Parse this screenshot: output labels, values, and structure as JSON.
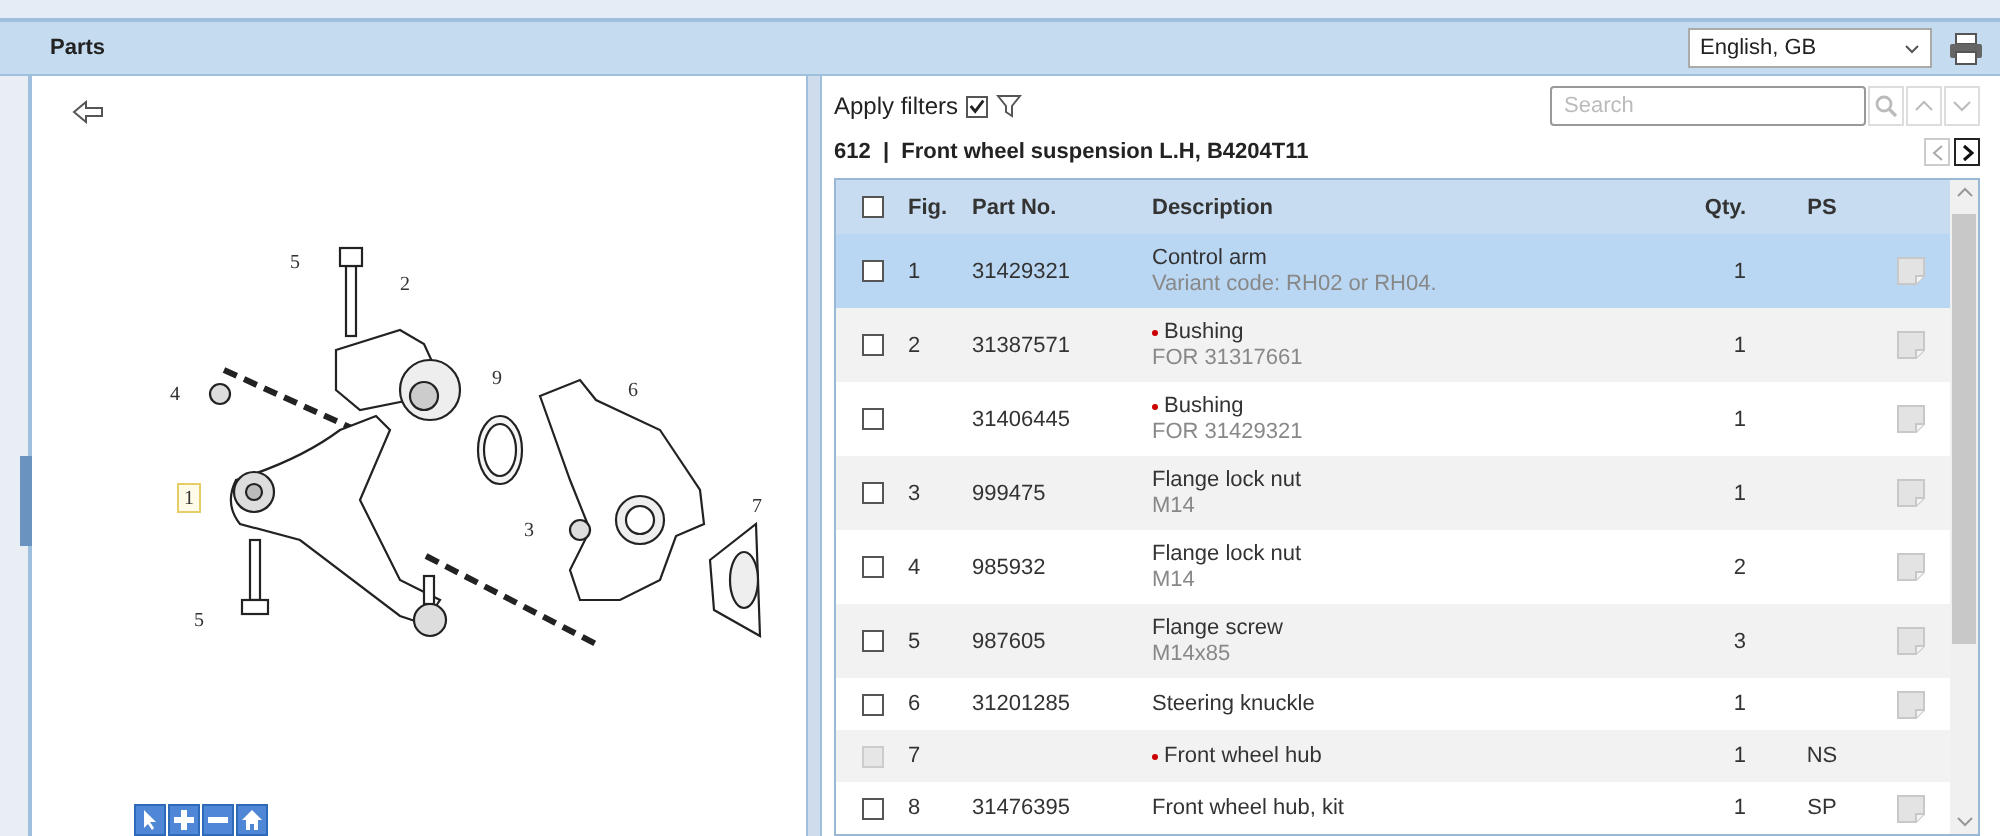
{
  "header": {
    "title": "Parts",
    "language": "English, GB"
  },
  "diagram": {
    "callouts": [
      {
        "label": "5",
        "selected": false
      },
      {
        "label": "2",
        "selected": false
      },
      {
        "label": "4",
        "selected": false
      },
      {
        "label": "9",
        "selected": false
      },
      {
        "label": "6",
        "selected": false
      },
      {
        "label": "1",
        "selected": true
      },
      {
        "label": "3",
        "selected": false
      },
      {
        "label": "5",
        "selected": false
      },
      {
        "label": "7",
        "selected": false
      }
    ]
  },
  "filters": {
    "label": "Apply filters",
    "checked": true
  },
  "search": {
    "placeholder": "Search"
  },
  "group": {
    "number": "612",
    "separator": "|",
    "title": "Front wheel suspension L.H, B4204T11"
  },
  "table": {
    "select_all": {
      "checked": false
    },
    "columns": [
      "Fig.",
      "Part No.",
      "Description",
      "Qty.",
      "PS"
    ],
    "rows": [
      {
        "fig": "1",
        "part_no": "31429321",
        "description": "Control arm",
        "note": "Variant code: RH02 or RH04.",
        "marked": false,
        "qty": "1",
        "ps": "",
        "has_doc": true,
        "checked": false,
        "disabled": false,
        "selected": true
      },
      {
        "fig": "2",
        "part_no": "31387571",
        "description": "Bushing",
        "note": "FOR 31317661",
        "marked": true,
        "qty": "1",
        "ps": "",
        "has_doc": true,
        "checked": false,
        "disabled": false,
        "selected": false
      },
      {
        "fig": "",
        "part_no": "31406445",
        "description": "Bushing",
        "note": "FOR 31429321",
        "marked": true,
        "qty": "1",
        "ps": "",
        "has_doc": true,
        "checked": false,
        "disabled": false,
        "selected": false
      },
      {
        "fig": "3",
        "part_no": "999475",
        "description": "Flange lock nut",
        "note": "M14",
        "marked": false,
        "qty": "1",
        "ps": "",
        "has_doc": true,
        "checked": false,
        "disabled": false,
        "selected": false
      },
      {
        "fig": "4",
        "part_no": "985932",
        "description": "Flange lock nut",
        "note": "M14",
        "marked": false,
        "qty": "2",
        "ps": "",
        "has_doc": true,
        "checked": false,
        "disabled": false,
        "selected": false
      },
      {
        "fig": "5",
        "part_no": "987605",
        "description": "Flange screw",
        "note": "M14x85",
        "marked": false,
        "qty": "3",
        "ps": "",
        "has_doc": true,
        "checked": false,
        "disabled": false,
        "selected": false
      },
      {
        "fig": "6",
        "part_no": "31201285",
        "description": "Steering knuckle",
        "note": "",
        "marked": false,
        "qty": "1",
        "ps": "",
        "has_doc": true,
        "checked": false,
        "disabled": false,
        "selected": false
      },
      {
        "fig": "7",
        "part_no": "",
        "description": "Front wheel hub",
        "note": "",
        "marked": true,
        "qty": "1",
        "ps": "NS",
        "has_doc": false,
        "checked": false,
        "disabled": true,
        "selected": false
      },
      {
        "fig": "8",
        "part_no": "31476395",
        "description": "Front wheel hub, kit",
        "note": "",
        "marked": false,
        "qty": "1",
        "ps": "SP",
        "has_doc": true,
        "checked": false,
        "disabled": false,
        "selected": false
      }
    ]
  }
}
